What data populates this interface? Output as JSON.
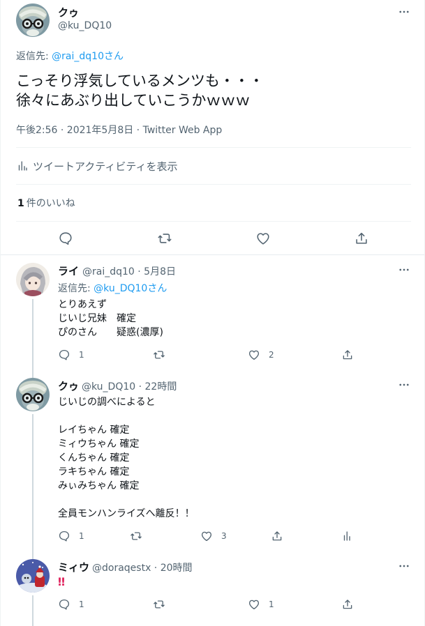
{
  "main_tweet": {
    "name": "クゥ",
    "handle": "@ku_DQ10",
    "reply_prefix": "返信先: ",
    "reply_to": "@rai_dq10さん",
    "text": "こっそり浮気しているメンツも・・・\n徐々にあぶり出していこうかｗｗｗ",
    "meta": "午後2:56 · 2021年5月8日 · Twitter Web App",
    "activity_label": "ツイートアクティビティを表示",
    "likes_count": "1",
    "likes_label": "件のいいね"
  },
  "replies": [
    {
      "name": "ライ",
      "handle_time": "@rai_dq10 · 5月8日",
      "reply_prefix": "返信先: ",
      "reply_to": "@ku_DQ10さん",
      "text": "とりあえず\nじいじ兄妹　確定\nぴのさん　　疑惑(濃厚)",
      "reply_count": "1",
      "retweet_count": "",
      "like_count": "2"
    },
    {
      "name": "クゥ",
      "handle_time": "@ku_DQ10 · 22時間",
      "text": "じいじの調べによると\n\nレイちゃん 確定\nミィウちゃん 確定\nくんちゃん 確定\nラキちゃん 確定\nみぃみちゃん 確定\n\n全員モンハンライズへ離反！！",
      "reply_count": "1",
      "retweet_count": "",
      "like_count": "3"
    },
    {
      "name": "ミィウ",
      "handle_time": "@doraqestx · 20時間",
      "text": "‼",
      "reply_count": "1",
      "retweet_count": "",
      "like_count": "1"
    }
  ],
  "colors": {
    "link": "#1d9bf0",
    "muted": "#536471",
    "text": "#0f1419",
    "thread_line": "#cfd9de",
    "alert": "#e0245e"
  },
  "icons": {
    "more": "more-horizontal-icon",
    "reply": "speech-bubble-icon",
    "retweet": "retweet-arrows-icon",
    "like": "heart-icon",
    "share": "share-upload-icon",
    "analytics": "bar-chart-icon"
  }
}
